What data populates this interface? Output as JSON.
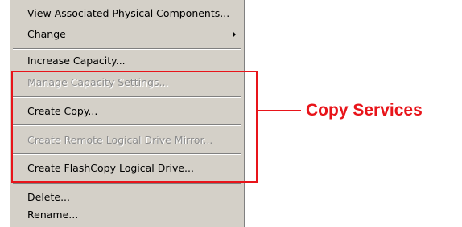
{
  "context_menu": {
    "items": [
      {
        "label": "View Associated Physical Components...",
        "enabled": true
      },
      {
        "label": "Change",
        "enabled": true,
        "has_submenu": true
      },
      {
        "label": "Increase Capacity...",
        "enabled": true
      },
      {
        "label": "Manage Capacity Settings...",
        "enabled": false
      },
      {
        "label": "Create Copy...",
        "enabled": true
      },
      {
        "label": "Create Remote Logical Drive Mirror...",
        "enabled": false
      },
      {
        "label": "Create FlashCopy Logical Drive...",
        "enabled": true
      },
      {
        "label": "Delete...",
        "enabled": true
      },
      {
        "label": "Rename...",
        "enabled": true
      }
    ]
  },
  "annotation": {
    "label": "Copy Services",
    "color": "#e8141a"
  },
  "colors": {
    "menu_background": "#d4d0c8",
    "disabled_text": "#8c8c8c"
  }
}
